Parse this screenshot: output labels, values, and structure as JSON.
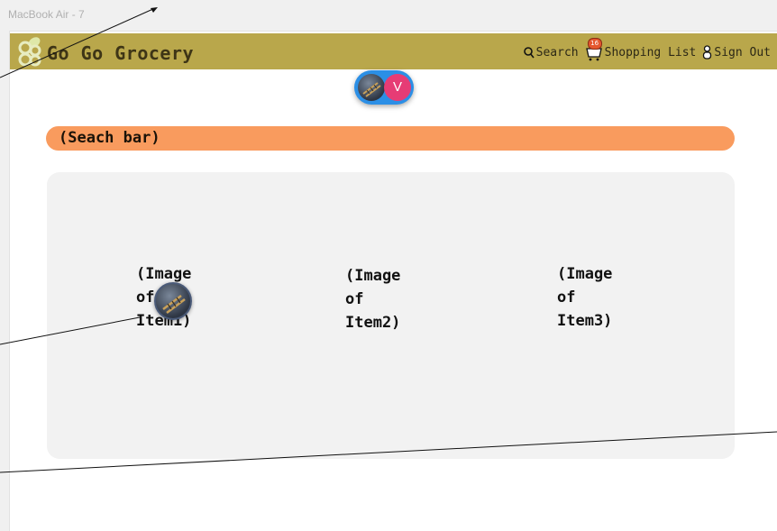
{
  "frame": {
    "label": "MacBook Air - 7"
  },
  "header": {
    "brand": "Go Go Grocery",
    "nav": {
      "search": "Search",
      "shopping_list": "Shopping List",
      "cart_count": "16",
      "sign_out": "Sign Out"
    }
  },
  "collaborators": {
    "initial": "V"
  },
  "search": {
    "placeholder": "(Seach bar)"
  },
  "items": [
    {
      "label": "(Image\nof\nItem1)"
    },
    {
      "label": "(Image\nof\nItem2)"
    },
    {
      "label": "(Image\nof\nItem3)"
    }
  ],
  "colors": {
    "navbar": "#b9a74b",
    "search_bar": "#f99b5e",
    "panel": "#f2f2f2",
    "avatar_letter_bg": "#e63c75",
    "avatar_group_bg": "#2b8fe6"
  },
  "icons": [
    "logo-icon",
    "search-icon",
    "cart-icon",
    "person-icon"
  ]
}
